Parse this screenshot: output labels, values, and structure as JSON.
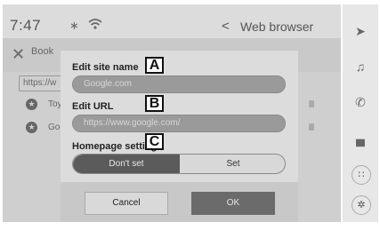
{
  "status_bar": {
    "time": "7:47",
    "bt_icon": "bluetooth-icon",
    "wifi_icon": "wifi-icon",
    "back": "<",
    "title": "Web browser"
  },
  "background": {
    "header_tab": "Book",
    "url_stub": "https://w",
    "rows": [
      {
        "label": "Toyo"
      },
      {
        "label": "Goo"
      }
    ]
  },
  "dialog": {
    "site_name_label": "Edit site name",
    "site_name_value": "Google.com",
    "url_label": "Edit URL",
    "url_value": "https://www.google.com/",
    "homepage_label": "Homepage setting",
    "option_dont_set": "Don't set",
    "option_set": "Set",
    "cancel": "Cancel",
    "ok": "OK"
  },
  "callouts": {
    "a": "A",
    "b": "B",
    "c": "C"
  },
  "sidebar": {
    "items": [
      {
        "icon": "navigation-arrow-icon",
        "glyph": "➤"
      },
      {
        "icon": "music-note-icon",
        "glyph": "♫"
      },
      {
        "icon": "phone-icon",
        "glyph": "✆"
      },
      {
        "icon": "car-icon",
        "glyph": "▄"
      },
      {
        "icon": "apps-icon",
        "glyph": "∷"
      },
      {
        "icon": "settings-gear-icon",
        "glyph": "✲"
      }
    ]
  },
  "colors": {
    "screen_bg": "#cfcfcf",
    "dialog_bg": "#dcdcdc",
    "selected_segment": "#5b5b5b",
    "ok_button": "#6b6b6b"
  }
}
